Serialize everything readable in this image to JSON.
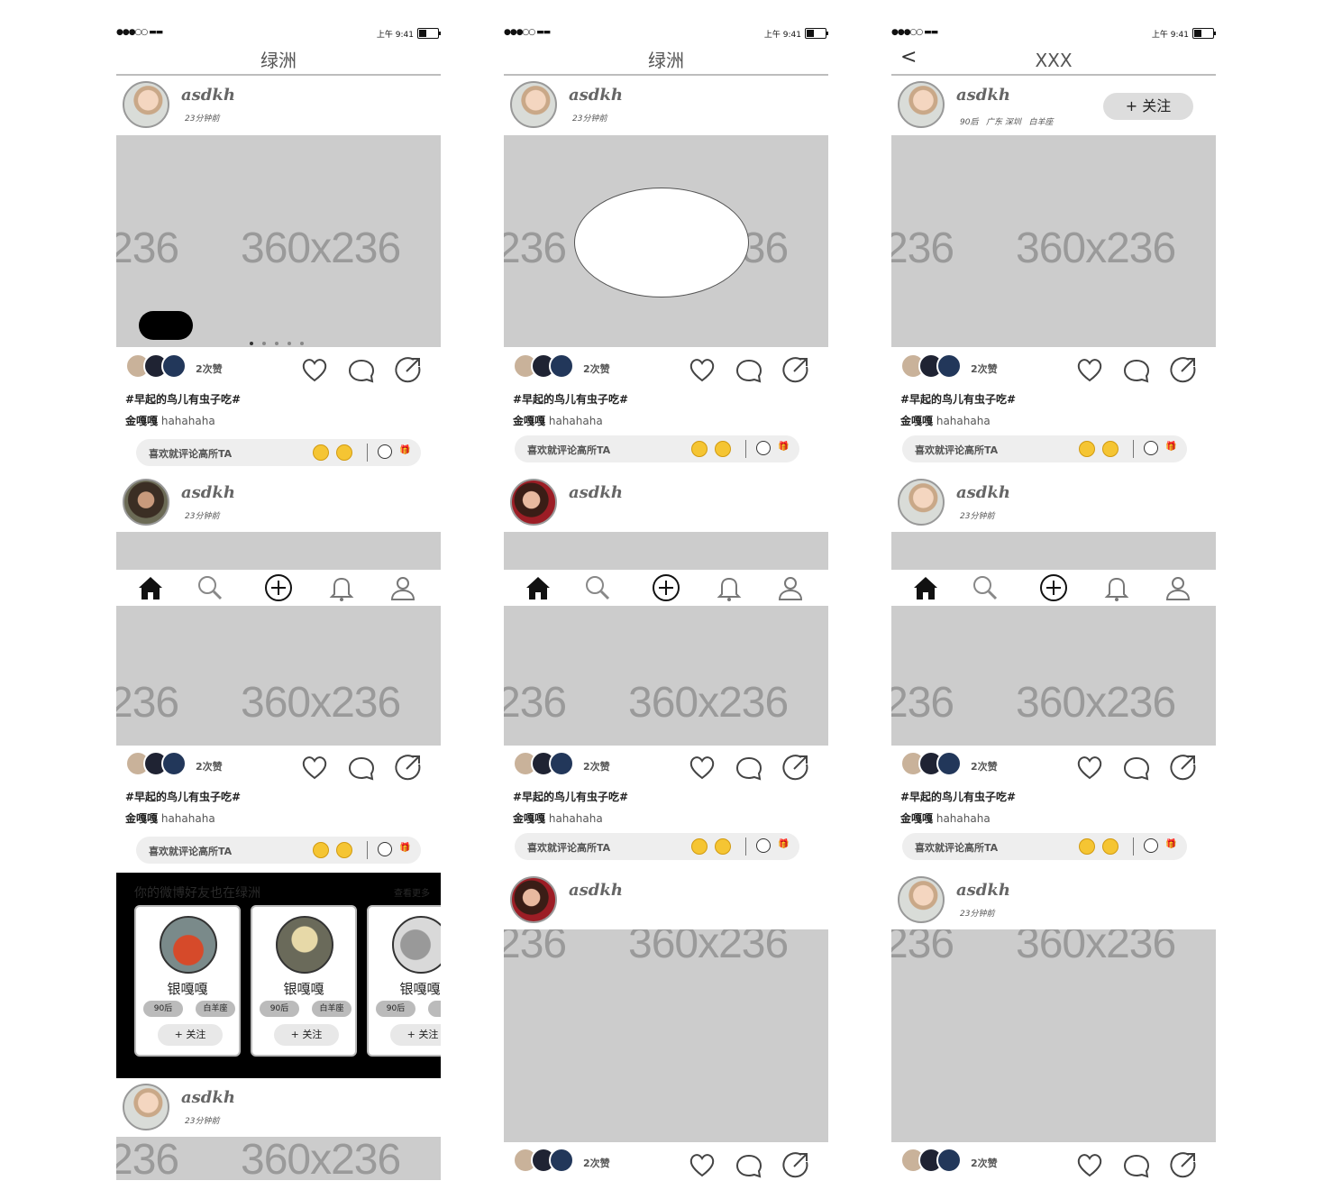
{
  "status": {
    "signal": "●●●○○ ▬▬",
    "time": "上午 9:41"
  },
  "screens": [
    {
      "title": "绿洲"
    },
    {
      "title": "绿洲"
    },
    {
      "title": "XXX",
      "back": "<"
    }
  ],
  "placeholder": {
    "l1": "236",
    "l2": "360x236"
  },
  "post": {
    "username": "asdkh",
    "time": "23分钟前",
    "likes": "2次赞",
    "tag": "#早起的鸟儿有虫子吃#",
    "author": "金嘎嘎",
    "text": "hahahaha",
    "comment_placeholder": "喜欢就评论高所TA",
    "gift": "🎁"
  },
  "profile_meta": {
    "age": "90后",
    "region": "广东 深圳",
    "sign": "白羊座"
  },
  "follow_label": "+ 关注",
  "suggest": {
    "title": "你的微博好友也在绿洲",
    "more": "查看更多",
    "cards": [
      {
        "name": "银嘎嘎",
        "age": "90后",
        "sign": "白羊座",
        "follow": "+ 关注"
      },
      {
        "name": "银嘎嘎",
        "age": "90后",
        "sign": "白羊座",
        "follow": "+ 关注"
      },
      {
        "name": "银嘎嘎",
        "age": "90后",
        "sign": "白",
        "follow": "+ 关注"
      }
    ]
  },
  "tabs": [
    "home-icon",
    "search-icon",
    "add-icon",
    "bell-icon",
    "profile-icon"
  ],
  "colors": {
    "placeholder": "#cccccc",
    "placeholder_text": "#9a9a9a",
    "header_line": "#bdbdbd"
  }
}
